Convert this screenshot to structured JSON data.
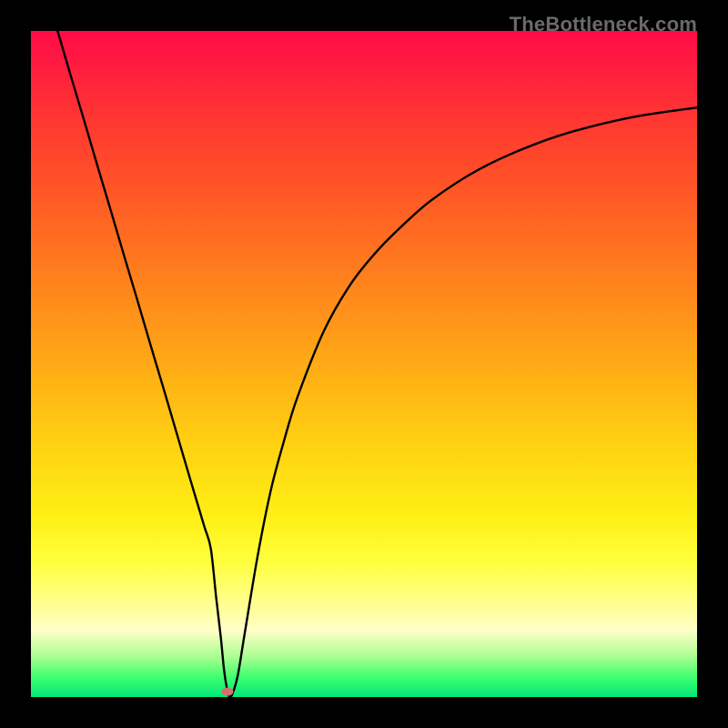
{
  "watermark": "TheBottleneck.com",
  "chart_data": {
    "type": "line",
    "title": "",
    "xlabel": "",
    "ylabel": "",
    "xlim": [
      0,
      100
    ],
    "ylim": [
      0,
      100
    ],
    "series": [
      {
        "name": "curve",
        "x": [
          4,
          6,
          8,
          10,
          12,
          14,
          16,
          18,
          20,
          22,
          24,
          26,
          27,
          27.8,
          28.5,
          29,
          29.5,
          30,
          31,
          32,
          34,
          36,
          38,
          40,
          44,
          48,
          52,
          56,
          60,
          66,
          72,
          80,
          90,
          100
        ],
        "y": [
          100,
          93.2,
          86.5,
          79.7,
          73.0,
          66.2,
          59.5,
          52.7,
          46.0,
          39.2,
          32.4,
          25.7,
          22.3,
          15.0,
          9.0,
          4.0,
          1.0,
          0.0,
          3.0,
          9.0,
          21.0,
          31.0,
          38.5,
          45.0,
          55.0,
          62.0,
          67.0,
          71.0,
          74.5,
          78.5,
          81.5,
          84.5,
          87.0,
          88.5
        ]
      }
    ],
    "marker": {
      "x": 29.5,
      "y": 0.8
    },
    "background_gradient": {
      "top": "#ff0b47",
      "mid": "#ffd412",
      "bottom": "#00e878"
    }
  }
}
